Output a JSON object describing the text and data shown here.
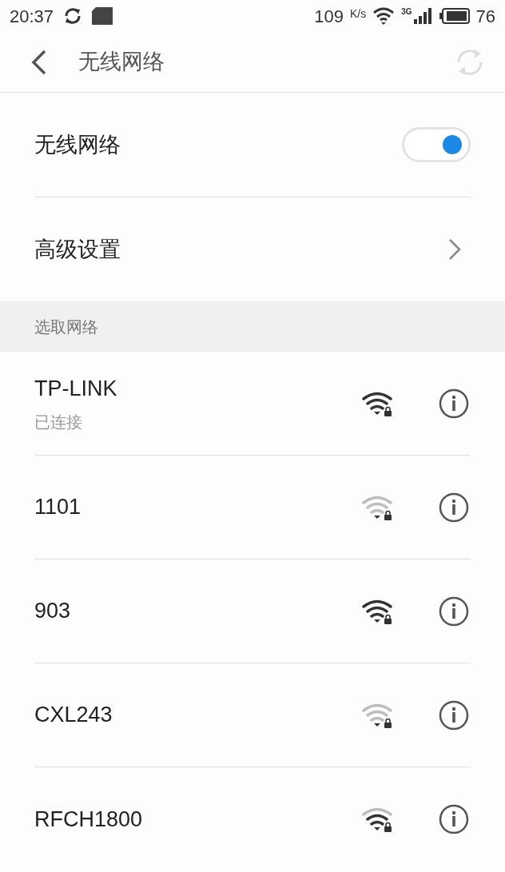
{
  "status_bar": {
    "time": "20:37",
    "speed": "109",
    "speed_unit": "K/s",
    "network_type": "3G",
    "battery": "76"
  },
  "header": {
    "title": "无线网络"
  },
  "wifi_toggle": {
    "label": "无线网络",
    "on": true
  },
  "advanced": {
    "label": "高级设置"
  },
  "section": {
    "title": "选取网络"
  },
  "networks": [
    {
      "name": "TP-LINK",
      "status": "已连接",
      "kind": "strong"
    },
    {
      "name": "1101",
      "kind": "weak"
    },
    {
      "name": "903",
      "kind": "strong"
    },
    {
      "name": "CXL243",
      "kind": "weak"
    },
    {
      "name": "RFCH1800",
      "kind": "medium"
    }
  ]
}
